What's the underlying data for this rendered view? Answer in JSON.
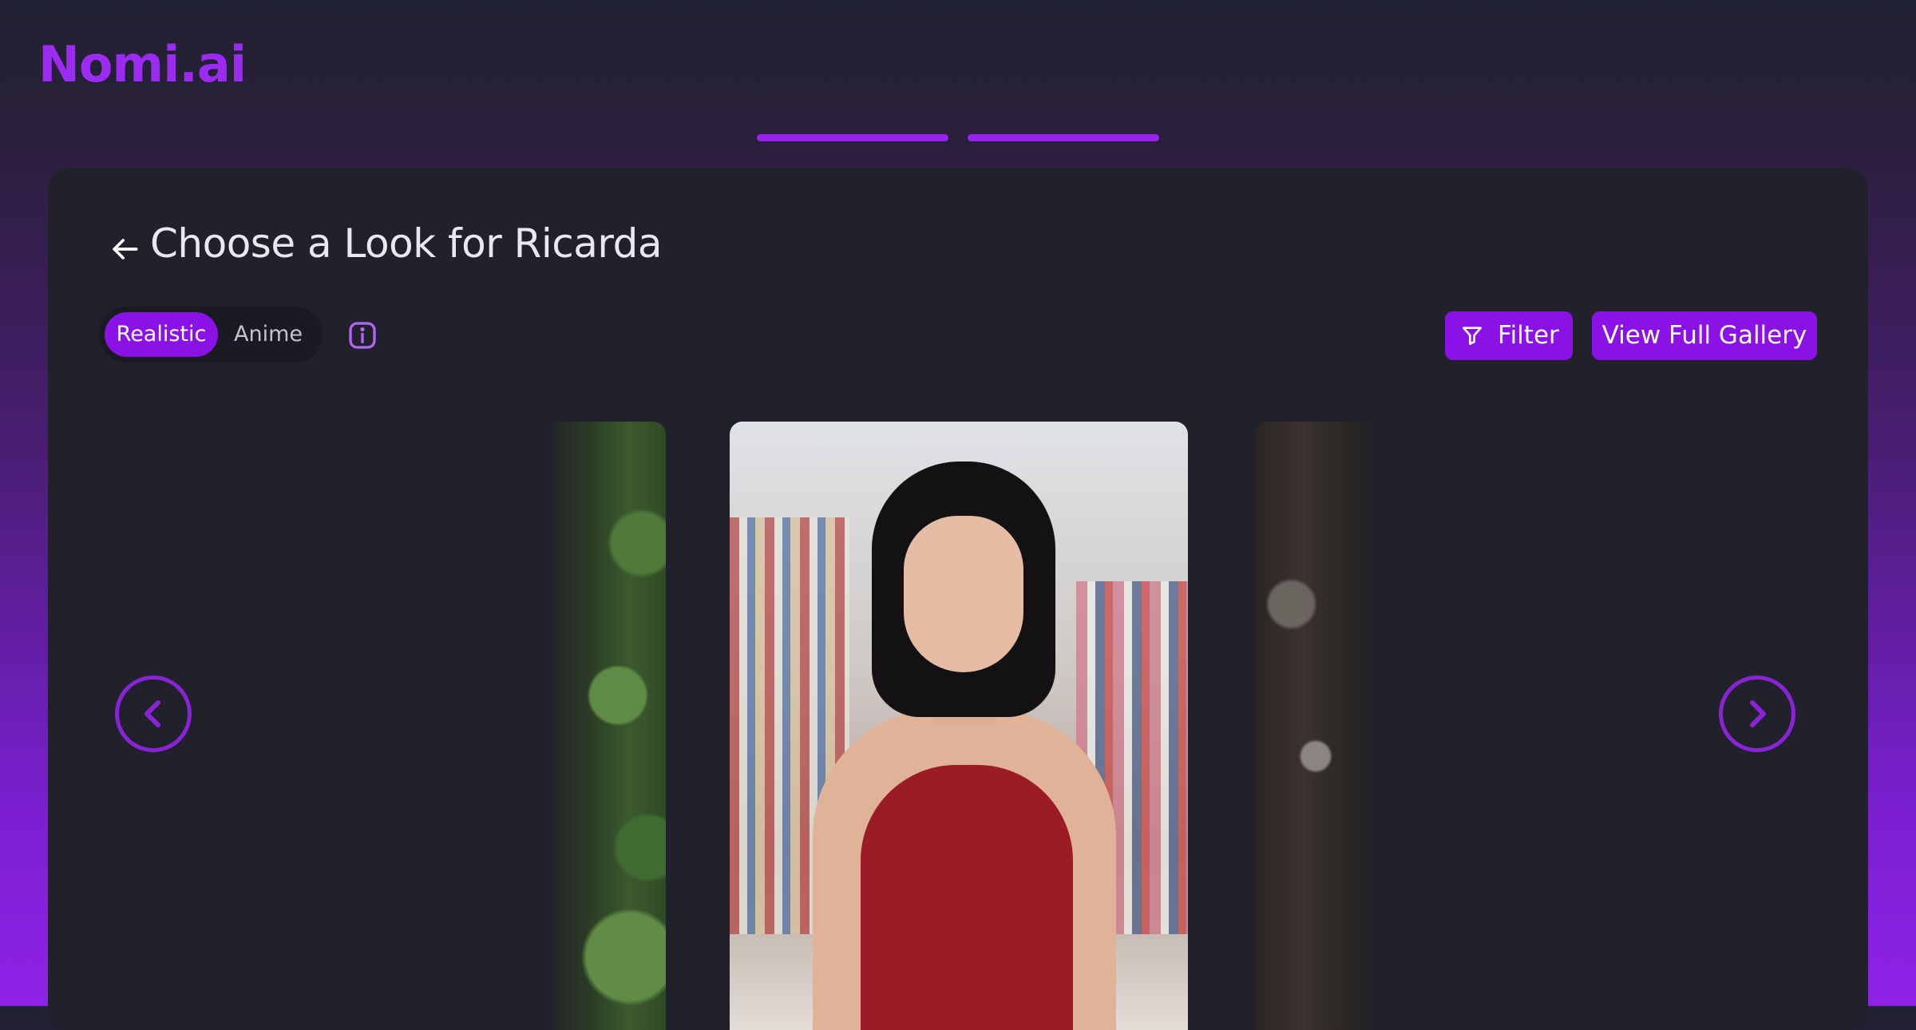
{
  "app": {
    "logo": "Nomi.ai",
    "brand_color": "#9c2bf2",
    "accent_color": "#8a12e6"
  },
  "progress": {
    "steps_total": 2,
    "steps_completed": 2
  },
  "page": {
    "title": "Choose a Look for Ricarda",
    "back_icon": "arrow-left-icon"
  },
  "style_toggle": {
    "options": [
      "Realistic",
      "Anime"
    ],
    "selected": "Realistic"
  },
  "info_icon": "info-icon",
  "toolbar": {
    "filter_label": "Filter",
    "filter_icon": "funnel-icon",
    "gallery_label": "View Full Gallery"
  },
  "carousel": {
    "prev_icon": "chevron-left-icon",
    "next_icon": "chevron-right-icon",
    "images": [
      {
        "position": "previous",
        "description_icon": "photo-thumbnail"
      },
      {
        "position": "current",
        "description_icon": "photo-main"
      },
      {
        "position": "next",
        "description_icon": "photo-thumbnail"
      }
    ]
  }
}
